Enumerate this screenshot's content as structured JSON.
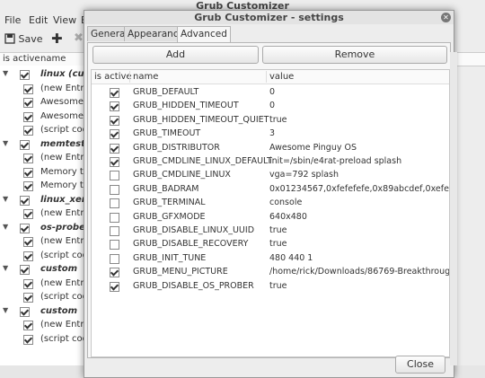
{
  "main": {
    "title": "Grub Customizer",
    "menu": [
      "File",
      "Edit",
      "View",
      "E"
    ],
    "toolbar": {
      "save_label": "Save"
    },
    "columns": [
      "is active",
      "name"
    ],
    "rows": [
      {
        "type": "group",
        "label": "linux (cus"
      },
      {
        "type": "item",
        "label": "(new Entrie"
      },
      {
        "type": "item",
        "label": "Awesome P"
      },
      {
        "type": "item",
        "label": "Awesome P"
      },
      {
        "type": "item",
        "label": "(script code"
      },
      {
        "type": "group",
        "label": "memtest8"
      },
      {
        "type": "item",
        "label": "(new Entrie"
      },
      {
        "type": "item",
        "label": "Memory tes"
      },
      {
        "type": "item",
        "label": "Memory tes"
      },
      {
        "type": "group",
        "label": "linux_xen"
      },
      {
        "type": "item",
        "label": "(new Entrie"
      },
      {
        "type": "group",
        "label": "os-prober"
      },
      {
        "type": "item",
        "label": "(new Entrie"
      },
      {
        "type": "item",
        "label": "(script code"
      },
      {
        "type": "group",
        "label": "custom"
      },
      {
        "type": "item",
        "label": "(new Entrie"
      },
      {
        "type": "item",
        "label": "(script code"
      },
      {
        "type": "group",
        "label": "custom"
      },
      {
        "type": "item",
        "label": "(new Entrie"
      },
      {
        "type": "item",
        "label": "(script code"
      }
    ]
  },
  "dialog": {
    "title": "Grub Customizer - settings",
    "tabs": [
      "General",
      "Appearance",
      "Advanced"
    ],
    "active_tab": "Advanced",
    "add_label": "Add",
    "remove_label": "Remove",
    "close_label": "Close",
    "columns": [
      "is active",
      "name",
      "value"
    ],
    "rows": [
      {
        "active": true,
        "name": "GRUB_DEFAULT",
        "value": "0"
      },
      {
        "active": true,
        "name": "GRUB_HIDDEN_TIMEOUT",
        "value": "0"
      },
      {
        "active": true,
        "name": "GRUB_HIDDEN_TIMEOUT_QUIET",
        "value": "true"
      },
      {
        "active": true,
        "name": "GRUB_TIMEOUT",
        "value": "3"
      },
      {
        "active": true,
        "name": "GRUB_DISTRIBUTOR",
        "value": "Awesome Pinguy OS"
      },
      {
        "active": true,
        "name": "GRUB_CMDLINE_LINUX_DEFAULT",
        "value": "init=/sbin/e4rat-preload splash"
      },
      {
        "active": false,
        "name": "GRUB_CMDLINE_LINUX",
        "value": "vga=792 splash"
      },
      {
        "active": false,
        "name": "GRUB_BADRAM",
        "value": "0x01234567,0xfefefefe,0x89abcdef,0xefefefef"
      },
      {
        "active": false,
        "name": "GRUB_TERMINAL",
        "value": "console"
      },
      {
        "active": false,
        "name": "GRUB_GFXMODE",
        "value": "640x480"
      },
      {
        "active": false,
        "name": "GRUB_DISABLE_LINUX_UUID",
        "value": "true"
      },
      {
        "active": false,
        "name": "GRUB_DISABLE_RECOVERY",
        "value": "true"
      },
      {
        "active": false,
        "name": "GRUB_INIT_TUNE",
        "value": "480 440 1"
      },
      {
        "active": true,
        "name": "GRUB_MENU_PICTURE",
        "value": "/home/rick/Downloads/86769-Breakthrough01.jpg"
      },
      {
        "active": true,
        "name": "GRUB_DISABLE_OS_PROBER",
        "value": "true"
      }
    ]
  }
}
